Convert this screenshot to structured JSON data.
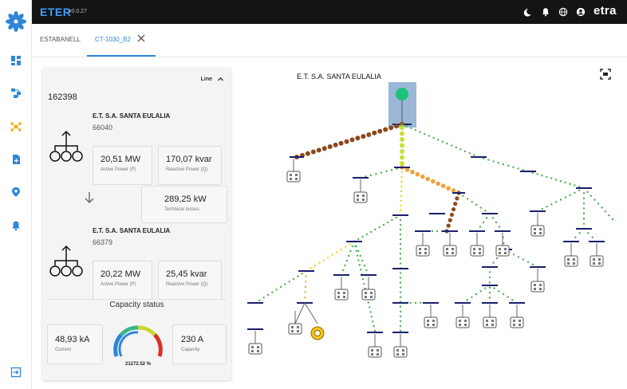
{
  "header": {
    "brand": "ETER",
    "version": "v0.0.27",
    "company": "etra",
    "icons": [
      "moon-icon",
      "bell-icon",
      "globe-icon",
      "account-icon"
    ]
  },
  "sidebar": {
    "items": [
      {
        "name": "dashboard-icon"
      },
      {
        "name": "network-map-icon"
      },
      {
        "name": "topology-icon",
        "active": true
      },
      {
        "name": "document-add-icon"
      },
      {
        "name": "location-pin-icon"
      },
      {
        "name": "alarm-bell-icon"
      }
    ],
    "logout_icon": "logout-icon"
  },
  "tabs": [
    {
      "label": "ESTABANELL",
      "active": false
    },
    {
      "label": "CT-1030_B2",
      "active": true
    }
  ],
  "panel": {
    "mode_label": "Line",
    "node_id": "162398",
    "source": {
      "name": "E.T. S.A. SANTA EULALIA",
      "code": "66040",
      "active_power": "20,51 MW",
      "active_power_label": "Active Power (P)",
      "reactive_power": "170,07 kvar",
      "reactive_power_label": "Reactive Power (Q)"
    },
    "losses": {
      "value": "289,25 kW",
      "label": "Technical losses"
    },
    "target": {
      "name": "E.T. S.A. SANTA EULALIA",
      "code": "66379",
      "active_power": "20,22 MW",
      "active_power_label": "Active Power (P)",
      "reactive_power": "25,45 kvar",
      "reactive_power_label": "Reactive Power (Q)"
    },
    "capacity": {
      "title": "Capacity status",
      "current_value": "48,93 kA",
      "current_label": "Current",
      "capacity_value": "230 A",
      "capacity_label": "Capacity",
      "percent_text": "21272.52 %"
    }
  },
  "diagram": {
    "title": "E.T. S.A. SANTA EULALIA",
    "colors": {
      "bus": "#1a1f6e",
      "line_ok": "#4caf50",
      "line_high": "#f2a33a",
      "line_over": "#8b4a1d",
      "line_light": "#c8e03a",
      "line_yellow": "#f5d020",
      "source_node": "#1ec27a",
      "selection": "#8aaad0"
    }
  }
}
